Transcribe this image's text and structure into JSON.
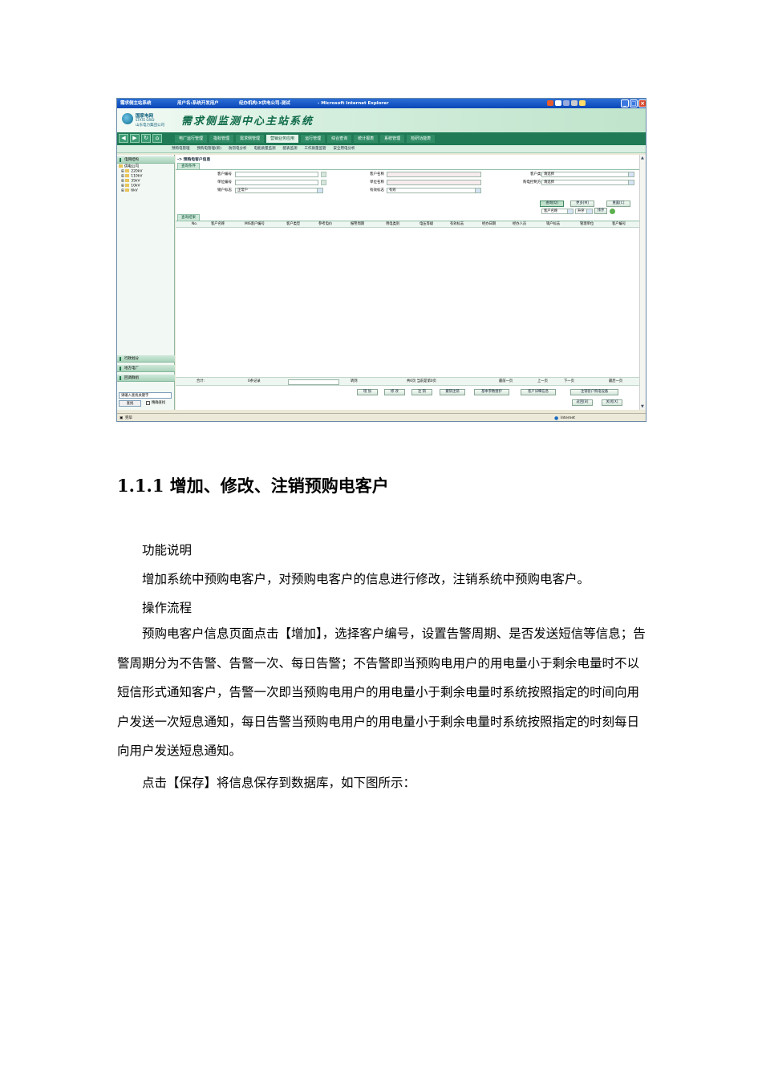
{
  "screenshot": {
    "window_title": "需求侧主站系统",
    "window_user": "用户名:系统开发用户",
    "window_org": "经办机构:X供电公司-测试",
    "window_app": "- Microsoft Internet Explorer",
    "logo_line1": "国家电网",
    "logo_line2": "STATE GRID",
    "logo_line3": "山东电力集团公司",
    "system_name": "需求侧监测中心主站系统",
    "menu": [
      "电厂运行管理",
      "指标管理",
      "需求侧管理",
      "营销业务应用",
      "运行管理",
      "综合查询",
      "统计报表",
      "系统管理",
      "检研功能表"
    ],
    "active_menu": "营销业务应用",
    "submenu": [
      "预购电管理",
      "预购电管理(新)",
      "防窃电分析",
      "电能质量监测",
      "配表监测",
      "工作质量监管",
      "安全用电分析"
    ],
    "left_panel": {
      "header_structure": "电网结构",
      "tree_root": "供电公司",
      "tree_items": [
        "220kV",
        "110kV",
        "35kV",
        "10kV",
        "6kV"
      ],
      "header_admin_region": "行政划分",
      "header_local_plant": "地方电厂",
      "header_line_group": "回调群组",
      "search_placeholder": "请输入查找关键字",
      "search_button": "查找",
      "exact_label": "精确查找"
    },
    "breadcrumb": "-> 预购电客户信息",
    "query_tab": "查询条件",
    "fields": {
      "customer_no_label": "客户编号",
      "customer_name_label": "客户名称",
      "customer_type_label": "客户类型",
      "customer_type_value": "请选择",
      "unit_no_label": "单位编号",
      "unit_name_label": "单位名称",
      "purchase_mode_label": "购电控制方式",
      "purchase_mode_value": "请选择",
      "household_label": "销户标志",
      "household_value": "正常户",
      "valid_label": "有效标志",
      "valid_value": "有效"
    },
    "buttons": {
      "query": "查询[Q]",
      "more": "更多[M]",
      "reset": "重置[C]",
      "add": "增 加",
      "modify": "修 改",
      "cancel": "注 销",
      "cancel_revoke": "撤销注销",
      "basic_params": "基本参数维护",
      "customer_detail": "客户详细信息",
      "cancel_device": "注销客户购电设备",
      "back": "返回[B]",
      "close": "关闭[X]"
    },
    "result_tab": "查询结果",
    "sort": {
      "field": "客户名称",
      "order": "升序",
      "button": "排序"
    },
    "columns": [
      "No.",
      "客户名称",
      "MIS客户编号",
      "客户类型",
      "参考电价",
      "报警周期",
      "用电类别",
      "电压等级",
      "有效标志",
      "经办日期",
      "经办人员",
      "销户标志",
      "管理单位",
      "客户编号"
    ],
    "pager": {
      "total_label": "合计:",
      "record_count": "0条记录",
      "goto_label": "转到",
      "page_info": "共0页 当前是第0页",
      "first": "最前一页",
      "prev": "上一页",
      "next": "下一页",
      "last": "最后一页"
    },
    "status_left": "完毕",
    "status_right": "Internet"
  },
  "document": {
    "heading": "1.1.1 增加、修改、注销预购电客户",
    "p1": "功能说明",
    "p2": "增加系统中预购电客户，对预购电客户的信息进行修改，注销系统中预购电客户。",
    "p3": "操作流程",
    "p4": "预购电客户信息页面点击【增加】，选择客户编号，设置告警周期、是否发送短信等信息；告警周期分为不告警、告警一次、每日告警；不告警即当预购电用户的用电量小于剩余电量时不以短信形式通知客户，告警一次即当预购电用户的用电量小于剩余电量时系统按照指定的时间向用户发送一次短息通知，每日告警当预购电用户的用电量小于剩余电量时系统按照指定的时刻每日向用户发送短息通知。",
    "p5": "点击【保存】将信息保存到数据库，如下图所示："
  }
}
